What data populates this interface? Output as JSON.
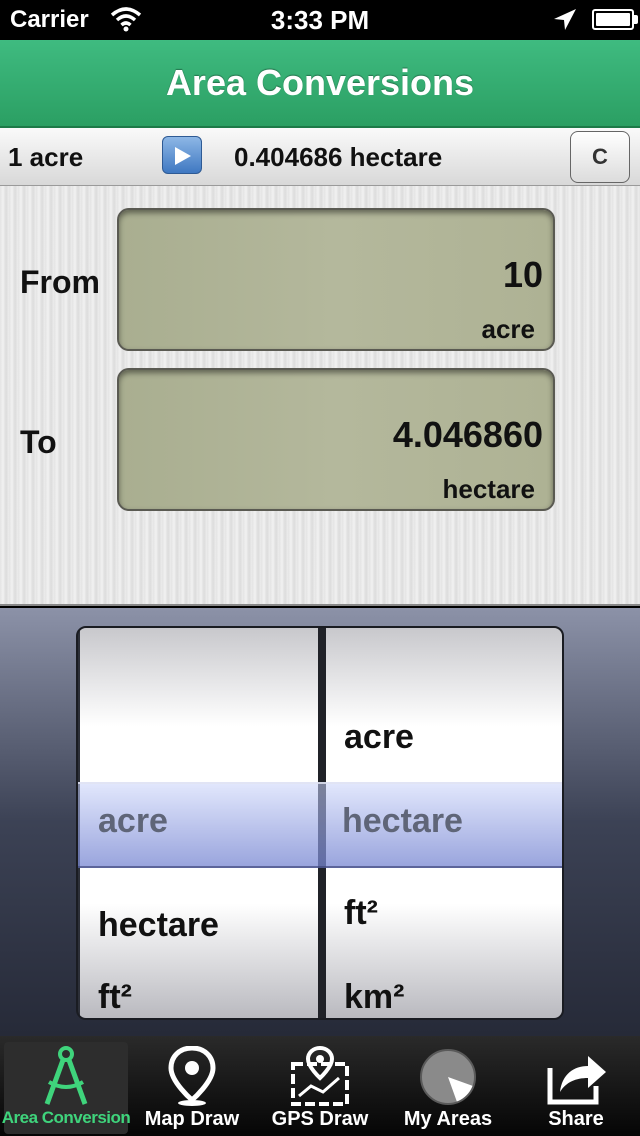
{
  "status": {
    "carrier": "Carrier",
    "time": "3:33 PM",
    "icons": [
      "wifi-icon",
      "location-arrow-icon",
      "battery-icon"
    ]
  },
  "header": {
    "title": "Area Conversions"
  },
  "result": {
    "from_text": "1 acre",
    "to_text": "0.404686 hectare",
    "clear_label": "C"
  },
  "from": {
    "label": "From",
    "value": "10",
    "unit": "acre"
  },
  "to": {
    "label": "To",
    "value": "4.046860",
    "unit": "hectare"
  },
  "picker": {
    "left_options": [
      "acre",
      "hectare",
      "ft²"
    ],
    "left_selected": "acre",
    "right_options": [
      "acre",
      "hectare",
      "ft²",
      "km²"
    ],
    "right_selected": "hectare"
  },
  "tabs": [
    {
      "label": "Area Conversion",
      "icon": "compass-icon",
      "active": true
    },
    {
      "label": "Map Draw",
      "icon": "map-pin-icon",
      "active": false
    },
    {
      "label": "GPS Draw",
      "icon": "gps-map-icon",
      "active": false
    },
    {
      "label": "My Areas",
      "icon": "pie-icon",
      "active": false
    },
    {
      "label": "Share",
      "icon": "share-icon",
      "active": false
    }
  ],
  "colors": {
    "header_green": "#3fbb80",
    "active_tab": "#3fd47c",
    "lcd": "#b0b494"
  }
}
